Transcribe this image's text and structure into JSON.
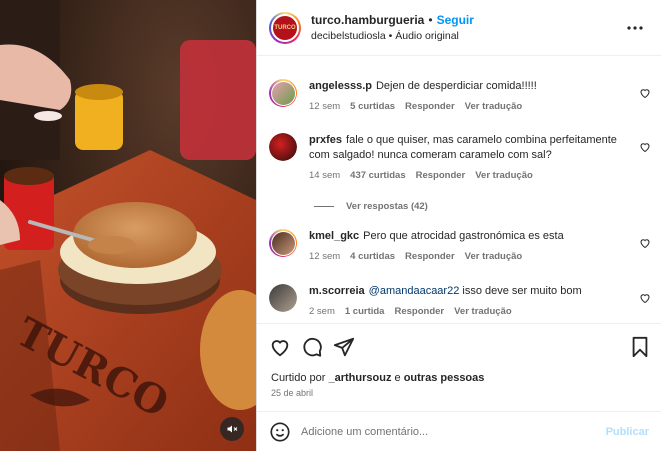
{
  "header": {
    "username": "turco.hamburgueria",
    "separator": "•",
    "follow_label": "Seguir",
    "audio_author": "decibelstudiosla",
    "audio_sep": "•",
    "audio_label": "Áudio original",
    "avatar_text": "TURCO",
    "more_icon": "more-horizontal-icon"
  },
  "media": {
    "brand_text": "TURCO",
    "mute_icon": "speaker-muted-icon"
  },
  "comments": [
    {
      "user": "angelesss.p",
      "text": "Dejen de desperdiciar comida!!!!!",
      "time": "12 sem",
      "likes": "5 curtidas",
      "reply": "Responder",
      "translate": "Ver tradução"
    },
    {
      "user": "prxfes",
      "text": "fale o que quiser, mas caramelo combina perfeitamente com salgado! nunca comeram caramelo com sal?",
      "time": "14 sem",
      "likes": "437 curtidas",
      "reply": "Responder",
      "translate": "Ver tradução"
    },
    {
      "user": "kmel_gkc",
      "text": "Pero que atrocidad gastronómica es esta",
      "time": "12 sem",
      "likes": "4 curtidas",
      "reply": "Responder",
      "translate": "Ver tradução"
    },
    {
      "user": "m.scorreia",
      "mention": "@amandaacaar22",
      "text": " isso deve ser muito bom",
      "time": "2 sem",
      "likes": "1 curtida",
      "reply": "Responder",
      "translate": "Ver tradução"
    }
  ],
  "view_replies": "Ver respostas (42)",
  "liked_by": {
    "prefix": "Curtido por ",
    "user": "_arthursouz",
    "middle": " e ",
    "others": "outras pessoas"
  },
  "date": "25 de abril",
  "add_comment": {
    "placeholder": "Adicione um comentário...",
    "post_label": "Publicar"
  },
  "colors": {
    "accent": "#0095f6",
    "post_disabled": "#b2dffc",
    "muted": "#737373"
  }
}
